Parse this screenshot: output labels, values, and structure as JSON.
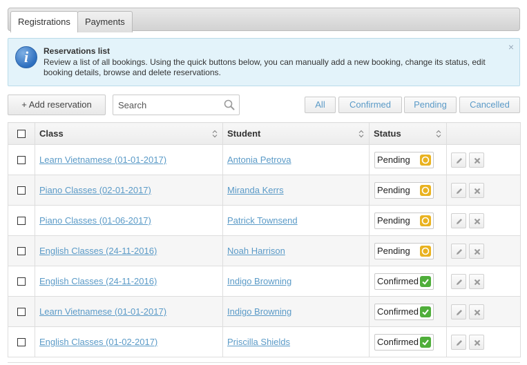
{
  "tabs": [
    {
      "label": "Registrations",
      "active": true
    },
    {
      "label": "Payments",
      "active": false
    }
  ],
  "info": {
    "icon": "info-icon",
    "title": "Reservations list",
    "text": "Review a list of all bookings. Using the quick buttons below, you can manually add a new booking, change its status, edit booking details, browse and delete reservations.",
    "close": "×"
  },
  "toolbar": {
    "add_label": "+ Add reservation",
    "search_placeholder": "Search",
    "filters": [
      "All",
      "Confirmed",
      "Pending",
      "Cancelled"
    ]
  },
  "table": {
    "columns": [
      "Class",
      "Student",
      "Status"
    ],
    "rows": [
      {
        "class": "Learn Vietnamese (01-01-2017)",
        "student": "Antonia Petrova",
        "status": "Pending"
      },
      {
        "class": "Piano Classes (02-01-2017)",
        "student": "Miranda Kerrs",
        "status": "Pending"
      },
      {
        "class": "Piano Classes (01-06-2017)",
        "student": "Patrick Townsend",
        "status": "Pending"
      },
      {
        "class": "English Classes (24-11-2016)",
        "student": "Noah Harrison",
        "status": "Pending"
      },
      {
        "class": "English Classes (24-11-2016)",
        "student": "Indigo Browning",
        "status": "Confirmed"
      },
      {
        "class": "Learn Vietnamese (01-01-2017)",
        "student": "Indigo Browning",
        "status": "Confirmed"
      },
      {
        "class": "English Classes (01-02-2017)",
        "student": "Priscilla Shields",
        "status": "Confirmed"
      }
    ]
  },
  "colors": {
    "link": "#5a9ac7",
    "pending": "#e9b220",
    "confirmed": "#4fae3a",
    "info_bg": "#e3f3fa"
  }
}
